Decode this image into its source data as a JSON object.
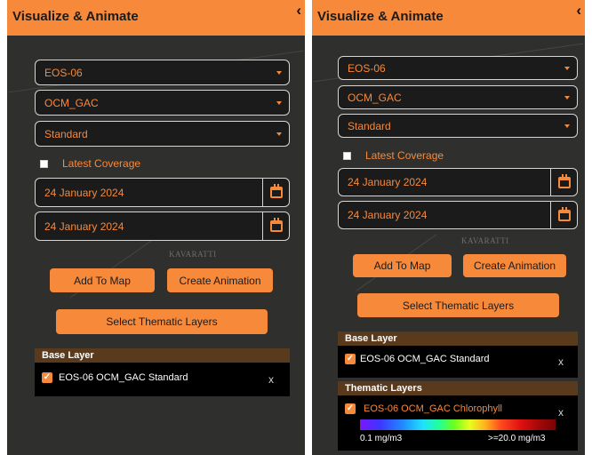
{
  "left": {
    "header": {
      "title": "Visualize & Animate",
      "collapse_glyph": "‹"
    },
    "satellite": {
      "value": "EOS-06"
    },
    "sensor": {
      "value": "OCM_GAC"
    },
    "product": {
      "value": "Standard"
    },
    "latest_coverage": {
      "label": "Latest Coverage",
      "checked": false
    },
    "start_date": {
      "value": "24 January 2024"
    },
    "end_date": {
      "value": "24 January 2024"
    },
    "map_label": "KAVARATTI",
    "add_to_map": "Add To Map",
    "create_animation": "Create Animation",
    "select_thematic": "Select Thematic Layers",
    "base_layer": {
      "title": "Base Layer",
      "items": [
        {
          "name": "EOS-06 OCM_GAC Standard",
          "remove": "x"
        }
      ]
    }
  },
  "right": {
    "header": {
      "title": "Visualize & Animate",
      "collapse_glyph": "‹"
    },
    "satellite": {
      "value": "EOS-06"
    },
    "sensor": {
      "value": "OCM_GAC"
    },
    "product": {
      "value": "Standard"
    },
    "latest_coverage": {
      "label": "Latest Coverage",
      "checked": false
    },
    "start_date": {
      "value": "24 January 2024"
    },
    "end_date": {
      "value": "24 January 2024"
    },
    "map_label": "KAVARATTI",
    "add_to_map": "Add To Map",
    "create_animation": "Create Animation",
    "select_thematic": "Select Thematic Layers",
    "base_layer": {
      "title": "Base Layer",
      "items": [
        {
          "name": "EOS-06 OCM_GAC Standard",
          "remove": "x"
        }
      ]
    },
    "thematic_layers": {
      "title": "Thematic Layers",
      "items": [
        {
          "name": "EOS-06 OCM_GAC Chlorophyll",
          "remove": "x",
          "legend_min": "0.1 mg/m3",
          "legend_max": ">=20.0 mg/m3"
        }
      ]
    }
  },
  "colors": {
    "accent": "#f7893a",
    "panel_bg": "#2f302d",
    "layer_header_bg": "#5a3a1d"
  },
  "icons": [
    "chevron-left-icon",
    "caret-down-icon",
    "calendar-icon",
    "checkbox-icon",
    "close-icon"
  ]
}
